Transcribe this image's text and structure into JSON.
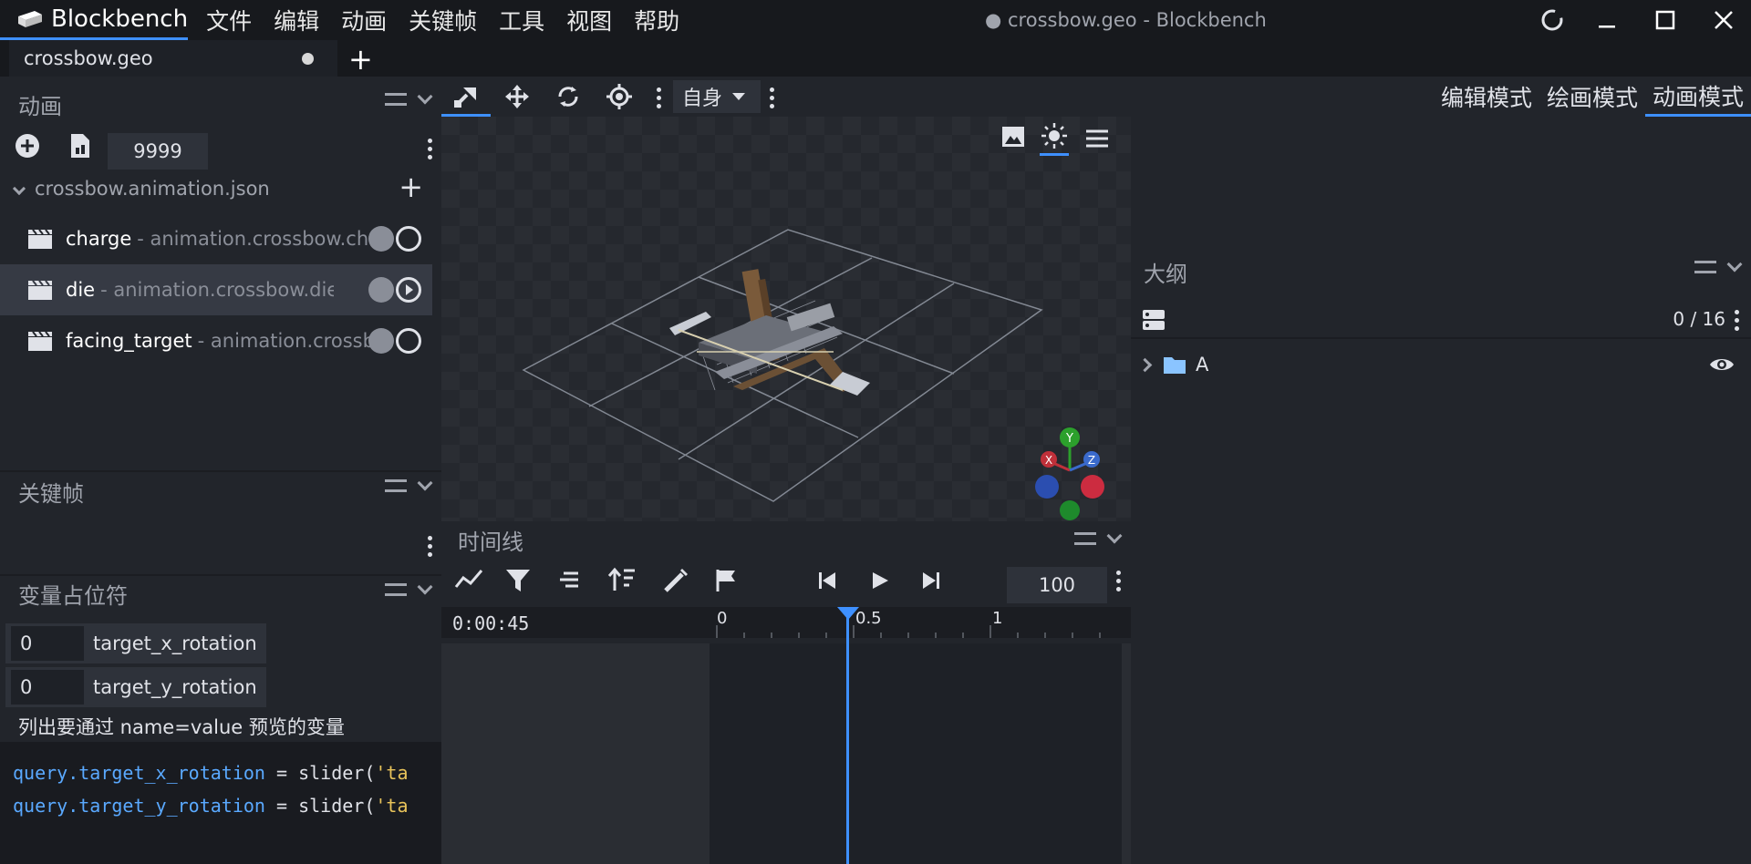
{
  "app": {
    "name": "Blockbench",
    "window_title": "● crossbow.geo - Blockbench"
  },
  "menu": [
    "文件",
    "编辑",
    "动画",
    "关键帧",
    "工具",
    "视图",
    "帮助"
  ],
  "tabs": [
    {
      "label": "crossbow.geo",
      "unsaved": true
    }
  ],
  "toolbar": {
    "space_label": "自身",
    "tools": [
      "transform-tool",
      "move-tool",
      "rotate-tool",
      "pivot-tool"
    ]
  },
  "modes": [
    {
      "label": "编辑模式",
      "active": false
    },
    {
      "label": "绘画模式",
      "active": false
    },
    {
      "label": "动画模式",
      "active": true
    }
  ],
  "animations_panel": {
    "title": "动画",
    "speed_value": "9999",
    "file": "crossbow.animation.json",
    "items": [
      {
        "name": "charge",
        "path": "- animation.crossbow.charge",
        "selected": false
      },
      {
        "name": "die",
        "path": "- animation.crossbow.die",
        "selected": true
      },
      {
        "name": "facing_target",
        "path": "- animation.crossbow.facing_target",
        "selected": false
      }
    ]
  },
  "keyframes_panel": {
    "title": "关键帧"
  },
  "variables_panel": {
    "title": "变量占位符",
    "sliders": [
      {
        "value": "0",
        "label": "target_x_rotation"
      },
      {
        "value": "0",
        "label": "target_y_rotation"
      }
    ],
    "hint": "列出要通过 name=value 预览的变量",
    "code_lines": [
      {
        "query": "query.target_x_rotation",
        "op": " = ",
        "fn": "slider(",
        "str": "'ta"
      },
      {
        "query": "query.target_y_rotation",
        "op": " = ",
        "fn": "slider(",
        "str": "'ta"
      }
    ]
  },
  "timeline": {
    "title": "时间线",
    "time": "0:00:45",
    "fps": "100",
    "ticks": [
      "0",
      "0.5",
      "1"
    ]
  },
  "outliner": {
    "title": "大纲",
    "count": "0 / 16",
    "nodes": [
      {
        "name": "A",
        "visible": true
      }
    ]
  },
  "colors": {
    "accent": "#3e90ff",
    "background": "#22252b"
  },
  "gizmo_labels": {
    "x": "X",
    "y": "Y",
    "z": "Z"
  }
}
